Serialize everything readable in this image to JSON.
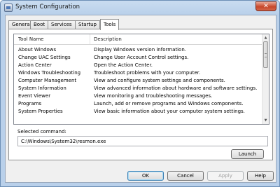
{
  "window": {
    "title": "System Configuration",
    "close_glyph": "✕"
  },
  "tabs": [
    "General",
    "Boot",
    "Services",
    "Startup",
    "Tools"
  ],
  "active_tab": "Tools",
  "list": {
    "headers": [
      "Tool Name",
      "Description"
    ],
    "rows": [
      {
        "name": "About Windows",
        "desc": "Display Windows version information."
      },
      {
        "name": "Change UAC Settings",
        "desc": "Change User Account Control settings."
      },
      {
        "name": "Action Center",
        "desc": "Open the Action Center."
      },
      {
        "name": "Windows Troubleshooting",
        "desc": "Troubleshoot problems with your computer."
      },
      {
        "name": "Computer Management",
        "desc": "View and configure system settings and components."
      },
      {
        "name": "System Information",
        "desc": "View advanced information about hardware and software settings."
      },
      {
        "name": "Event Viewer",
        "desc": "View monitoring and troubleshooting messages."
      },
      {
        "name": "Programs",
        "desc": "Launch, add or remove programs and Windows components."
      },
      {
        "name": "System Properties",
        "desc": "View basic information about your computer system settings."
      }
    ]
  },
  "selected_command": {
    "label": "Selected command:",
    "value": "C:\\Windows\\System32\\resmon.exe"
  },
  "buttons": {
    "launch": "Launch",
    "ok": "OK",
    "cancel": "Cancel",
    "apply": "Apply",
    "help": "Help"
  },
  "icons": {
    "scroll_up": "▲",
    "scroll_down": "▼"
  },
  "colors": {
    "title_gradient_top": "#c9dcf0",
    "close_button": "#c7472a",
    "focus_border": "#3c7fb1"
  }
}
